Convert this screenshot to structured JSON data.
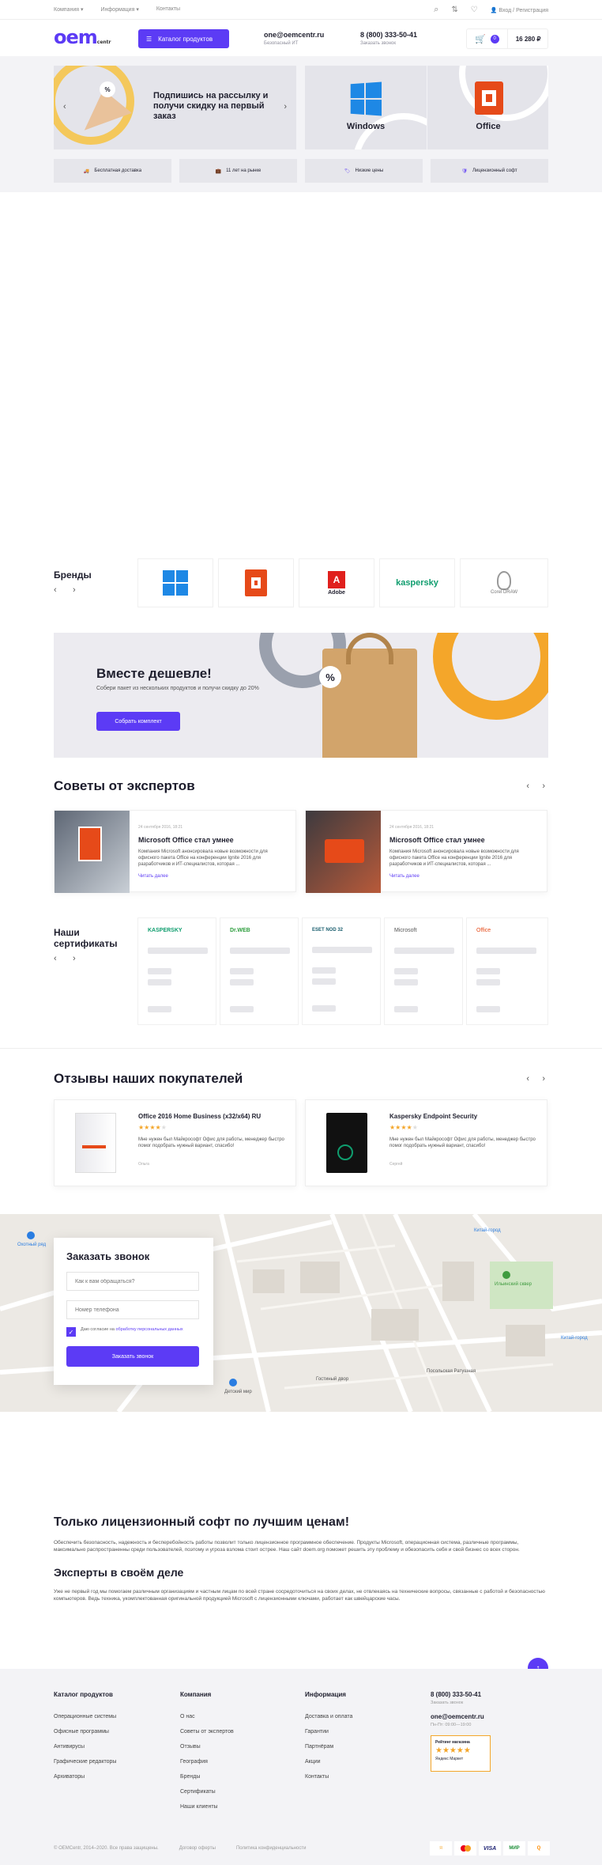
{
  "topbar": {
    "nav": [
      "Компания",
      "Информация",
      "Контакты"
    ],
    "login": "Вход / Регистрация"
  },
  "header": {
    "logo": "oem",
    "logo_sub": "centr",
    "catalog_btn": "Каталог продуктов",
    "email": "one@oemcentr.ru",
    "email_sub": "Безопасный ИТ",
    "phone": "8 (800) 333-50-41",
    "phone_sub": "Заказать звонок",
    "cart_count": "0",
    "cart_total": "16 280 ₽"
  },
  "promo": {
    "subscribe_text": "Подпишись на рассылку и получи скидку на первый заказ",
    "windows": "Windows",
    "office": "Office"
  },
  "features": [
    "Бесплатная доставка",
    "11 лет на рынке",
    "Низкие цены",
    "Лицензионный софт"
  ],
  "brands": {
    "title": "Бренды",
    "items": [
      "Adobe",
      "kaspersky",
      "Corel DRAW"
    ]
  },
  "bundle": {
    "title": "Вместе дешевле!",
    "subtitle": "Собери пакет из нескольких продуктов и получи скидку до 20%",
    "button": "Собрать комплект"
  },
  "experts": {
    "title": "Советы от экспертов",
    "articles": [
      {
        "date": "24 сентября 2016, 18:21",
        "title": "Microsoft Office стал умнее",
        "text": "Компания Microsoft анонсировала новые возможности для офисного пакета Office на конференции Ignite 2016 для разработчиков и ИТ-специалистов, которая ...",
        "link": "Читать далее"
      },
      {
        "date": "24 сентября 2016, 18:21",
        "title": "Microsoft Office стал умнее",
        "text": "Компания Microsoft анонсировала новые возможности для офисного пакета Office на конференции Ignite 2016 для разработчиков и ИТ-специалистов, которая ...",
        "link": "Читать далее"
      }
    ]
  },
  "certificates": {
    "title": "Наши сертификаты",
    "items": [
      "KASPERSKY",
      "Dr.WEB",
      "ESET NOD 32",
      "Microsoft",
      "Office"
    ]
  },
  "reviews": {
    "title": "Отзывы наших покупателей",
    "items": [
      {
        "product": "Office 2016 Home Business (x32/x64) RU",
        "text": "Мне нужен был Майкрософт Офис для работы, менеджер быстро помог подобрать нужный вариант, спасибо!",
        "author": "Ольга"
      },
      {
        "product": "Kaspersky Endpoint Security",
        "text": "Мне нужен был Майкрософт Офис для работы, менеджер быстро помог подобрать нужный вариант, спасибо!",
        "author": "Сергей"
      }
    ]
  },
  "callback": {
    "title": "Заказать звонок",
    "name_placeholder": "Как к вам обращаться?",
    "phone_placeholder": "Номер телефона",
    "consent_prefix": "Даю согласие на ",
    "consent_link": "обработку персональных данных",
    "button": "Заказать звонок"
  },
  "map_labels": [
    "Охотный ряд",
    "Китай-город",
    "Ильинский сквер",
    "Гостиный двор",
    "Детский мир",
    "Китай-город",
    "Посольская Ратушная"
  ],
  "seo": {
    "title1": "Только лицензионный софт по лучшим ценам!",
    "text1": "Обеспечить безопасность, надежность и бесперебойность работы позволит только лицензионное программное обеспечение. Продукты Microsoft, операционная система, различные программы, максимально распространенны среди пользователей, поэтому и угроза взлома стоит острее. Наш сайт doem.org поможет решить эту проблему и обезопасить себя и свой бизнес со всех сторон.",
    "title2": "Эксперты в своём деле",
    "text2": "Уже не первый год мы помогаем различным организациям и частным лицам по всей стране сосредоточиться на своих делах, не отвлекаясь на технические вопросы, связанные с работой и безопасностью компьютеров. Ведь техника, укомплектованная оригинальной продукцией Microsoft с лицензионными ключами, работает как швейцарские часы."
  },
  "footer": {
    "col1_title": "Каталог продуктов",
    "col1": [
      "Операционные системы",
      "Офисные программы",
      "Антивирусы",
      "Графические редакторы",
      "Архиваторы"
    ],
    "col2_title": "Компания",
    "col2": [
      "О нас",
      "Советы от экспертов",
      "Отзывы",
      "География",
      "Бренды",
      "Сертификаты",
      "Наши клиенты"
    ],
    "col3_title": "Информация",
    "col3": [
      "Доставка и оплата",
      "Гарантии",
      "Партнёрам",
      "Акции",
      "Контакты"
    ],
    "phone": "8 (800) 333-50-41",
    "phone_sub": "Заказать звонок",
    "email": "one@oemcentr.ru",
    "email_sub": "Пн-Пт: 09:00—19:00",
    "rating_title": "Рейтинг магазина",
    "rating_market": "Яндекс Маркет",
    "copyright": "© OEMCentr, 2014–2020. Все права защищены.",
    "offer": "Договор оферты",
    "privacy": "Политика конфиденциальности",
    "payment": [
      "Яндекс",
      "MasterCard",
      "VISA",
      "МИР",
      "QIWI"
    ]
  },
  "colors": {
    "accent": "#5c3bf5",
    "orange": "#f4a62a",
    "windows": "#1e88e5",
    "office": "#e64a19"
  }
}
